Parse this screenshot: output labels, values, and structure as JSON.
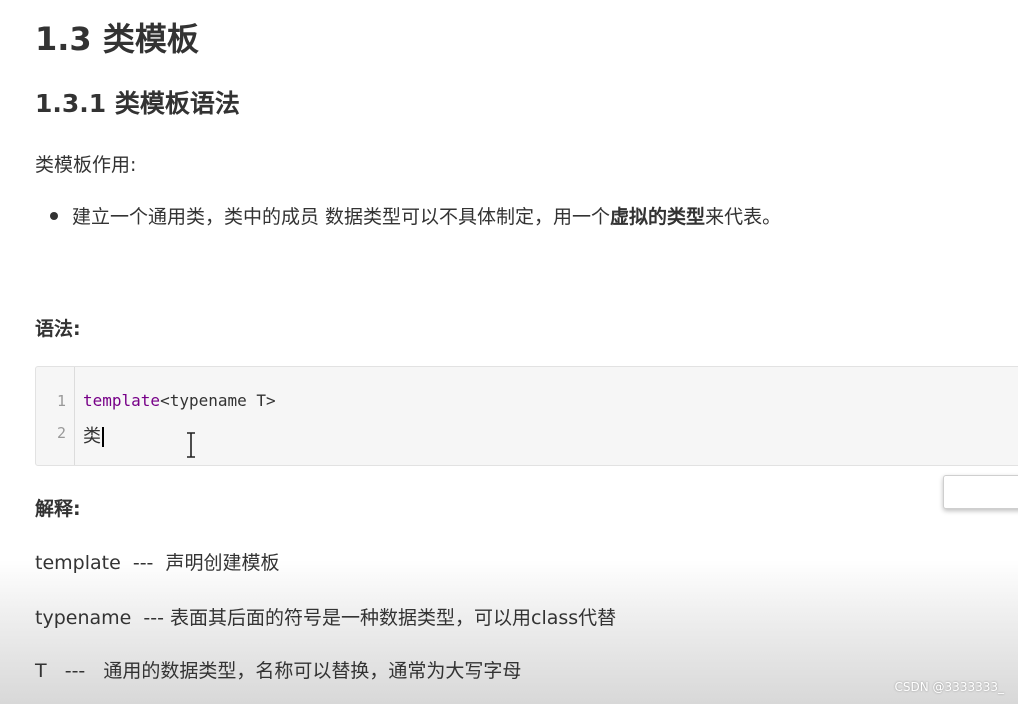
{
  "heading1": "1.3 类模板",
  "heading2": "1.3.1 类模板语法",
  "intro_label": "类模板作用:",
  "bullet": {
    "text_before": "建立一个通用类，类中的成员 数据类型可以不具体制定，用一个",
    "bold_text": "虚拟的类型",
    "text_after": "来代表。"
  },
  "syntax_label": "语法:",
  "code": {
    "lines": [
      {
        "num": "1",
        "keyword": "template",
        "rest": "<typename T>"
      },
      {
        "num": "2",
        "text": "类"
      }
    ]
  },
  "explain_label": "解释:",
  "explanations": [
    "template  ---  声明创建模板",
    "typename  --- 表面其后面的符号是一种数据类型，可以用class代替",
    "T   ---   通用的数据类型，名称可以替换，通常为大写字母"
  ],
  "watermark": "CSDN @3333333_",
  "colors": {
    "keyword": "#770088",
    "text": "#333333",
    "code_bg": "#f6f6f6"
  }
}
